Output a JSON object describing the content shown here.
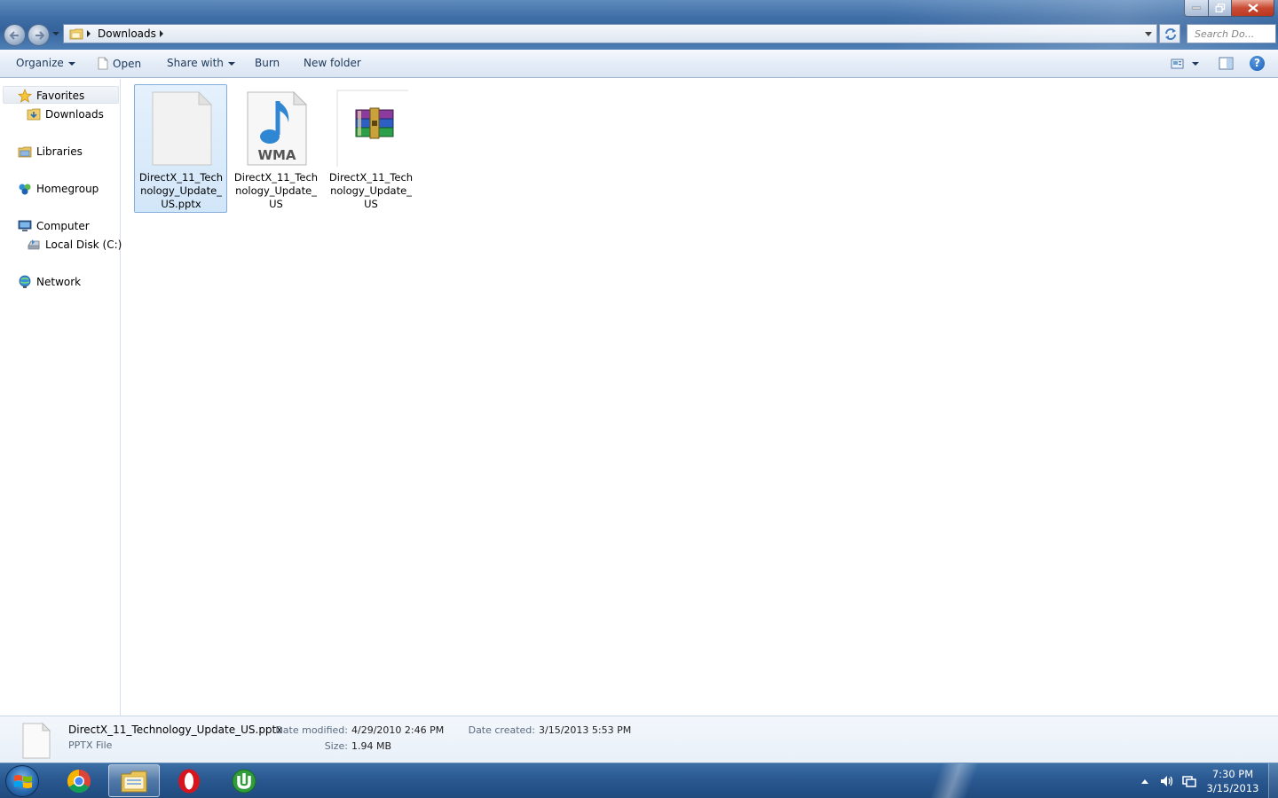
{
  "window": {
    "controls": {
      "minimize": "minimize",
      "maximize": "maximize",
      "close": "close"
    }
  },
  "address": {
    "crumbs": [
      "Downloads"
    ],
    "icon": "folder-icon"
  },
  "search": {
    "placeholder": "Search Do..."
  },
  "toolbar": {
    "organize_label": "Organize",
    "open_label": "Open",
    "share_label": "Share with",
    "burn_label": "Burn",
    "new_folder_label": "New folder"
  },
  "nav": {
    "favorites": "Favorites",
    "downloads": "Downloads",
    "libraries": "Libraries",
    "homegroup": "Homegroup",
    "computer": "Computer",
    "local_disk": "Local Disk (C:)",
    "network": "Network"
  },
  "files": [
    {
      "name": "DirectX_11_Technology_Update_US.pptx",
      "icon": "blank-document-icon",
      "selected": true
    },
    {
      "name": "DirectX_11_Technology_Update_US",
      "icon": "wma-audio-icon",
      "badge": "WMA",
      "selected": false
    },
    {
      "name": "DirectX_11_Technology_Update_US",
      "icon": "winrar-archive-icon",
      "selected": false
    }
  ],
  "details": {
    "filename": "DirectX_11_Technology_Update_US.pptx",
    "filetype": "PPTX File",
    "date_modified_label": "Date modified:",
    "date_modified": "4/29/2010 2:46 PM",
    "size_label": "Size:",
    "size": "1.94 MB",
    "date_created_label": "Date created:",
    "date_created": "3/15/2013 5:53 PM"
  },
  "taskbar": {
    "apps": [
      "chrome-icon",
      "explorer-icon",
      "opera-icon",
      "utorrent-icon"
    ],
    "clock_time": "7:30 PM",
    "clock_date": "3/15/2013"
  },
  "colors": {
    "accent": "#3f6ea6",
    "selection": "#d2e6f9",
    "taskbar": "#2a5890",
    "close": "#c7432b"
  }
}
